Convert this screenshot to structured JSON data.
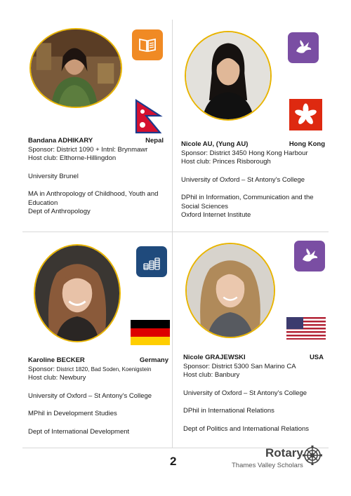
{
  "page_number": "2",
  "footer": {
    "brand": "Rotary",
    "subtitle": "Thames Valley Scholars"
  },
  "scholars": [
    {
      "name": "Bandana ADHIKARY",
      "country": "Nepal",
      "category_icon": "book-icon",
      "category_color": "#f08a24",
      "flag": "nepal-flag",
      "sponsor_label": "Sponsor:",
      "sponsor": "District 1090   + Intnl: Brynmawr",
      "host_label": "Host club:",
      "host": "Elthorne-Hillingdon",
      "university": "University   Brunel",
      "degree": "MA in Anthropology of Childhood, Youth and Education",
      "dept": "Dept of Anthropology"
    },
    {
      "name": "Nicole AU, (Yung AU)",
      "country": "Hong Kong",
      "category_icon": "dove-icon",
      "category_color": "#7a4ea3",
      "flag": "hong-kong-flag",
      "sponsor_label": "Sponsor:",
      "sponsor": "District 3450 Hong Kong Harbour",
      "host_label": "Host club:",
      "host": "Princes Risborough",
      "university": "University of Oxford – St Antony's College",
      "degree": "DPhil in Information, Communication and the Social Sciences",
      "dept": "Oxford Internet Institute"
    },
    {
      "name": "Karoline BECKER",
      "country": "Germany",
      "category_icon": "coins-icon",
      "category_color": "#1f4a7c",
      "flag": "germany-flag",
      "sponsor_label": "Sponsor:",
      "sponsor": "District 1820, Bad Soden, Koenigstein",
      "host_label": "Host club:",
      "host": "Newbury",
      "university": "University of Oxford –   St Antony's College",
      "degree": "MPhil in Development Studies",
      "dept": "Dept of International Development"
    },
    {
      "name": "Nicole GRAJEWSKI",
      "country": "USA",
      "category_icon": "dove-icon",
      "category_color": "#7a4ea3",
      "flag": "usa-flag",
      "sponsor_label": "Sponsor:",
      "sponsor": "District 5300 San Marino CA",
      "host_label": "Host club:",
      "host": "Banbury",
      "university": "University of Oxford – St Antony's College",
      "degree": "DPhil in International Relations",
      "dept": "Dept of Politics and International Relations"
    }
  ]
}
